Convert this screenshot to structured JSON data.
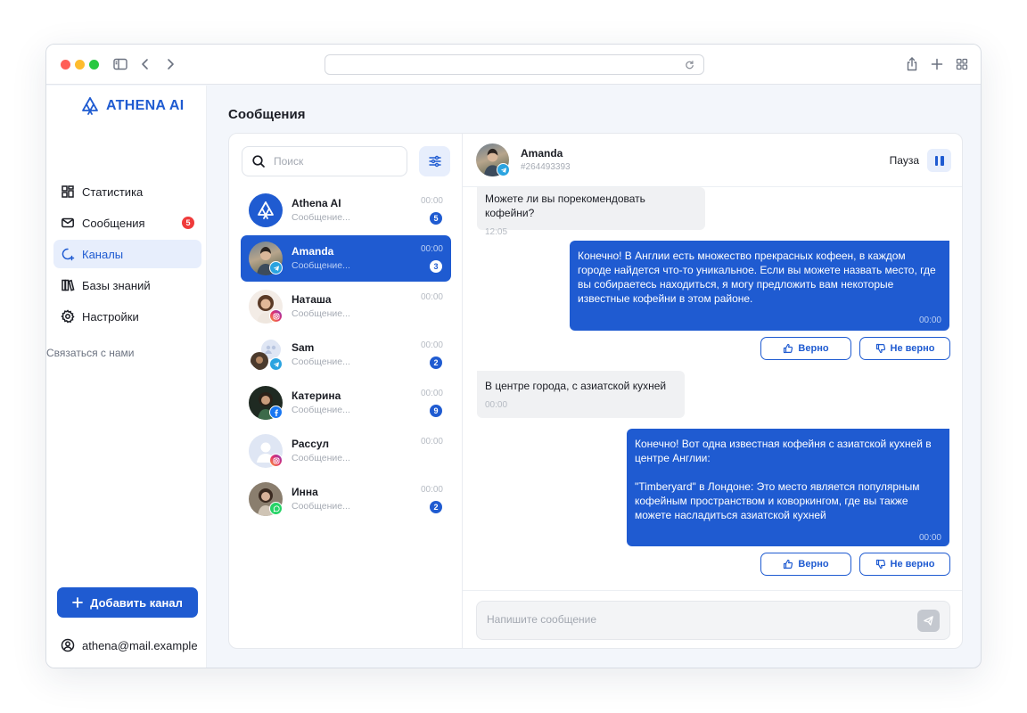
{
  "colors": {
    "accent": "#1f5bd1",
    "badge_red": "#ef3b3b",
    "accent_light": "#e7eefc"
  },
  "browser": {
    "traffic_lights": [
      "close",
      "minimize",
      "zoom"
    ],
    "url": ""
  },
  "sidebar": {
    "logo_text": "ATHENA AI",
    "items": [
      {
        "label": "Статистика",
        "icon": "dashboard-icon"
      },
      {
        "label": "Сообщения",
        "icon": "mail-icon",
        "badge": "5"
      },
      {
        "label": "Каналы",
        "icon": "channel-icon"
      },
      {
        "label": "Базы знаний",
        "icon": "books-icon"
      },
      {
        "label": "Настройки",
        "icon": "gear-icon"
      }
    ],
    "contact_link": "Связаться с нами",
    "add_channel": "Добавить канал",
    "user_email": "athena@mail.example"
  },
  "main": {
    "title": "Сообщения",
    "search_placeholder": "Поиск",
    "conversations": [
      {
        "name": "Athena AI",
        "preview": "Сообщение...",
        "time": "00:00",
        "unread": "5",
        "channel": "none"
      },
      {
        "name": "Amanda",
        "preview": "Сообщение...",
        "time": "00:00",
        "unread": "3",
        "channel": "telegram"
      },
      {
        "name": "Наташа",
        "preview": "Сообщение...",
        "time": "00:00",
        "unread": "",
        "channel": "instagram"
      },
      {
        "name": "Sam",
        "preview": "Сообщение...",
        "time": "00:00",
        "unread": "2",
        "channel": "telegram"
      },
      {
        "name": "Катерина",
        "preview": "Сообщение...",
        "time": "00:00",
        "unread": "9",
        "channel": "facebook"
      },
      {
        "name": "Рассул",
        "preview": "Сообщение...",
        "time": "00:00",
        "unread": "",
        "channel": "instagram"
      },
      {
        "name": "Инна",
        "preview": "Сообщение...",
        "time": "00:00",
        "unread": "2",
        "channel": "whatsapp"
      }
    ]
  },
  "chat": {
    "name": "Amanda",
    "id": "#264493393",
    "pause_label": "Пауза",
    "messages": [
      {
        "dir": "in",
        "text": "Можете ли вы порекомендовать кофейни?",
        "time": "12:05"
      },
      {
        "dir": "out",
        "text": "Конечно! В Англии есть множество прекрасных кофеен, в каждом городе найдется что-то уникальное. Если вы можете назвать место, где вы собираетесь находиться, я могу предложить вам некоторые известные кофейни в этом районе.",
        "time": "00:00"
      },
      {
        "dir": "in",
        "text": "В центре города, с азиатской кухней",
        "time": "00:00"
      },
      {
        "dir": "out",
        "text": "Конечно! Вот одна известная кофейня с азиатской кухней в центре Англии:",
        "text2": "\"Timberyard\" в Лондоне: Это место является популярным кофейным пространством и коворкингом, где вы также можете насладиться азиатской кухней",
        "time": "00:00"
      }
    ],
    "feedback_yes": "Верно",
    "feedback_no": "Не верно",
    "composer_placeholder": "Напишите сообщение"
  }
}
